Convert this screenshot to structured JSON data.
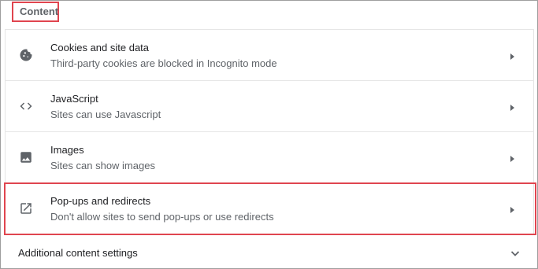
{
  "section": {
    "title": "Content"
  },
  "rows": [
    {
      "title": "Cookies and site data",
      "description": "Third-party cookies are blocked in Incognito mode",
      "icon": "cookie-icon"
    },
    {
      "title": "JavaScript",
      "description": "Sites can use Javascript",
      "icon": "code-icon"
    },
    {
      "title": "Images",
      "description": "Sites can show images",
      "icon": "image-icon"
    },
    {
      "title": "Pop-ups and redirects",
      "description": "Don't allow sites to send pop-ups or use redirects",
      "icon": "open-in-new-icon"
    }
  ],
  "additional": {
    "label": "Additional content settings",
    "icon": "chevron-down-icon"
  },
  "colors": {
    "highlight": "#e0454f",
    "icon": "#5f6368",
    "title_text": "#202124",
    "secondary_text": "#5f6368"
  }
}
